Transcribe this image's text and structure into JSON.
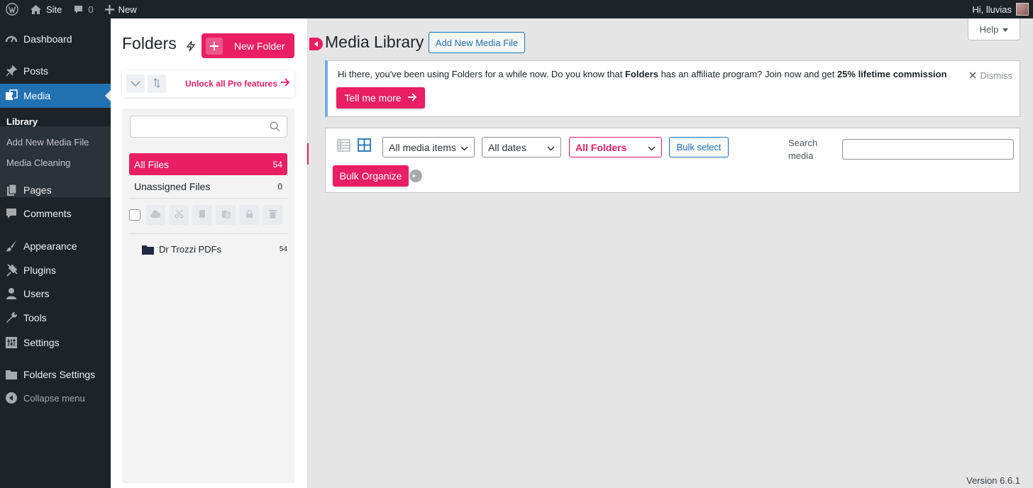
{
  "adminbar": {
    "site": "Site",
    "comments_count": "0",
    "new_label": "New",
    "greeting": "Hi, lluvias"
  },
  "menu": {
    "dashboard": "Dashboard",
    "posts": "Posts",
    "media": "Media",
    "submenu": [
      "Library",
      "Add New Media File",
      "Media Cleaning"
    ],
    "pages": "Pages",
    "comments": "Comments",
    "appearance": "Appearance",
    "plugins": "Plugins",
    "users": "Users",
    "tools": "Tools",
    "settings": "Settings",
    "folders_settings": "Folders Settings",
    "collapse": "Collapse menu"
  },
  "folders": {
    "title": "Folders",
    "new_folder": "New Folder",
    "unlock_pro": "Unlock all Pro features",
    "search_placeholder": "",
    "all_files": {
      "label": "All Files",
      "count": "54"
    },
    "unassigned": {
      "label": "Unassigned Files",
      "count": "0"
    },
    "items": [
      {
        "name": "Dr Trozzi PDFs",
        "count": "54"
      }
    ]
  },
  "main": {
    "title": "Media Library",
    "add_new": "Add New Media File",
    "help": "Help",
    "notice": {
      "text_1": "Hi there, you've been using Folders for a while now. Do you know that ",
      "bold_1": "Folders",
      "text_2": " has an affiliate program? Join now and get ",
      "bold_2": "25% lifetime commission",
      "cta": "Tell me more",
      "dismiss": "Dismiss"
    },
    "toolbar": {
      "media_filter": "All media items",
      "date_filter": "All dates",
      "folder_filter": "All Folders",
      "bulk_select": "Bulk select",
      "search_label": "Search media",
      "search_value": "",
      "bulk_organize": "Bulk Organize"
    }
  },
  "footer": {
    "version": "Version 6.6.1"
  },
  "colors": {
    "accent": "#e91e63",
    "wp_blue": "#2271b1",
    "sidebar": "#1d2327"
  }
}
